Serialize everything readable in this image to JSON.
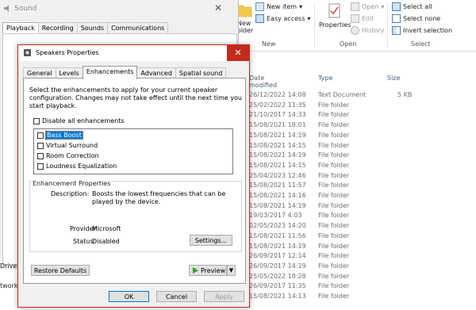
{
  "explorer": {
    "ribbon": {
      "new_folder": "New\nfolder",
      "new_item": "New item",
      "easy_access": "Easy access",
      "properties": "Properties",
      "open": "Open",
      "edit": "Edit",
      "history": "History",
      "select_all": "Select all",
      "select_none": "Select none",
      "invert_selection": "Invert selection",
      "group_new": "New",
      "group_open": "Open",
      "group_select": "Select"
    },
    "columns": {
      "date_modified": "Date modified",
      "type": "Type",
      "size": "Size"
    },
    "rows": [
      {
        "date": "26/12/2022 14:08",
        "type": "Text Document",
        "size": "5 KB"
      },
      {
        "date": "25/02/2022 11:35",
        "type": "File folder",
        "size": ""
      },
      {
        "date": "21/10/2017 14:33",
        "type": "File folder",
        "size": ""
      },
      {
        "date": "15/08/2021 18:01",
        "type": "File folder",
        "size": ""
      },
      {
        "date": "15/08/2021 14:19",
        "type": "File folder",
        "size": ""
      },
      {
        "date": "15/08/2021 14:15",
        "type": "File folder",
        "size": ""
      },
      {
        "date": "15/08/2021 14:19",
        "type": "File folder",
        "size": ""
      },
      {
        "date": "15/08/2021 14:15",
        "type": "File folder",
        "size": ""
      },
      {
        "date": "25/04/2023 12:46",
        "type": "File folder",
        "size": ""
      },
      {
        "date": "15/08/2021 11:57",
        "type": "File folder",
        "size": ""
      },
      {
        "date": "15/08/2021 14:16",
        "type": "File folder",
        "size": ""
      },
      {
        "date": "15/08/2021 14:19",
        "type": "File folder",
        "size": ""
      },
      {
        "date": "19/03/2017 4:03",
        "type": "File folder",
        "size": ""
      },
      {
        "date": "02/05/2023 14:20",
        "type": "File folder",
        "size": ""
      },
      {
        "date": "15/08/2021 11:56",
        "type": "File folder",
        "size": ""
      },
      {
        "date": "15/08/2021 14:19",
        "type": "File folder",
        "size": ""
      },
      {
        "date": "26/09/2017 12:14",
        "type": "File folder",
        "size": ""
      },
      {
        "date": "26/09/2017 14:19",
        "type": "File folder",
        "size": ""
      },
      {
        "date": "25/05/2022 18:28",
        "type": "File folder",
        "size": ""
      },
      {
        "date": "26/09/2017 11:35",
        "type": "File folder",
        "size": ""
      },
      {
        "date": "15/08/2021 14:13",
        "type": "File folder",
        "size": ""
      }
    ]
  },
  "sound": {
    "title": "Sound",
    "tabs": [
      "Playback",
      "Recording",
      "Sounds",
      "Communications"
    ],
    "side_labels": [
      "Drive",
      "twork"
    ]
  },
  "dialog": {
    "title": "Speakers Properties",
    "tabs": [
      "General",
      "Levels",
      "Enhancements",
      "Advanced",
      "Spatial sound"
    ],
    "selected_tab": "Enhancements",
    "description": "Select the enhancements to apply for your current speaker configuration. Changes may not take effect until the next time you start playback.",
    "disable_all": "Disable all enhancements",
    "enhancements": [
      "Bass Boost",
      "Virtual Surround",
      "Room Correction",
      "Loudness Equalization"
    ],
    "properties": {
      "legend": "Enhancement Properties",
      "description_label": "Description:",
      "description_value": "Boosts the lowest frequencies that can be played by the device.",
      "provider_label": "Provider:",
      "provider_value": "Microsoft",
      "status_label": "Status:",
      "status_value": "Disabled",
      "settings_button": "Settings..."
    },
    "restore_defaults": "Restore Defaults",
    "preview": "Preview",
    "ok": "OK",
    "cancel": "Cancel",
    "apply": "Apply"
  }
}
